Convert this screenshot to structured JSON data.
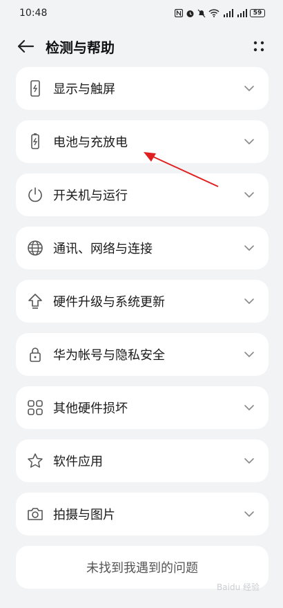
{
  "status_bar": {
    "time": "10:48",
    "battery": "59"
  },
  "header": {
    "title": "检测与帮助"
  },
  "items": [
    {
      "label": "显示与触屏",
      "icon": "phone-touch-icon"
    },
    {
      "label": "电池与充放电",
      "icon": "battery-charging-icon"
    },
    {
      "label": "开关机与运行",
      "icon": "power-icon"
    },
    {
      "label": "通讯、网络与连接",
      "icon": "globe-icon"
    },
    {
      "label": "硬件升级与系统更新",
      "icon": "upgrade-arrow-icon"
    },
    {
      "label": "华为帐号与隐私安全",
      "icon": "lock-icon"
    },
    {
      "label": "其他硬件损坏",
      "icon": "grid-apps-icon"
    },
    {
      "label": "软件应用",
      "icon": "star-icon"
    },
    {
      "label": "拍摄与图片",
      "icon": "camera-icon"
    }
  ],
  "footer": {
    "label": "未找到我遇到的问题"
  },
  "watermark": {
    "text": "Baidu 经验"
  },
  "colors": {
    "background": "#f1f3f5",
    "card": "#ffffff",
    "annotation": "#e02020"
  }
}
